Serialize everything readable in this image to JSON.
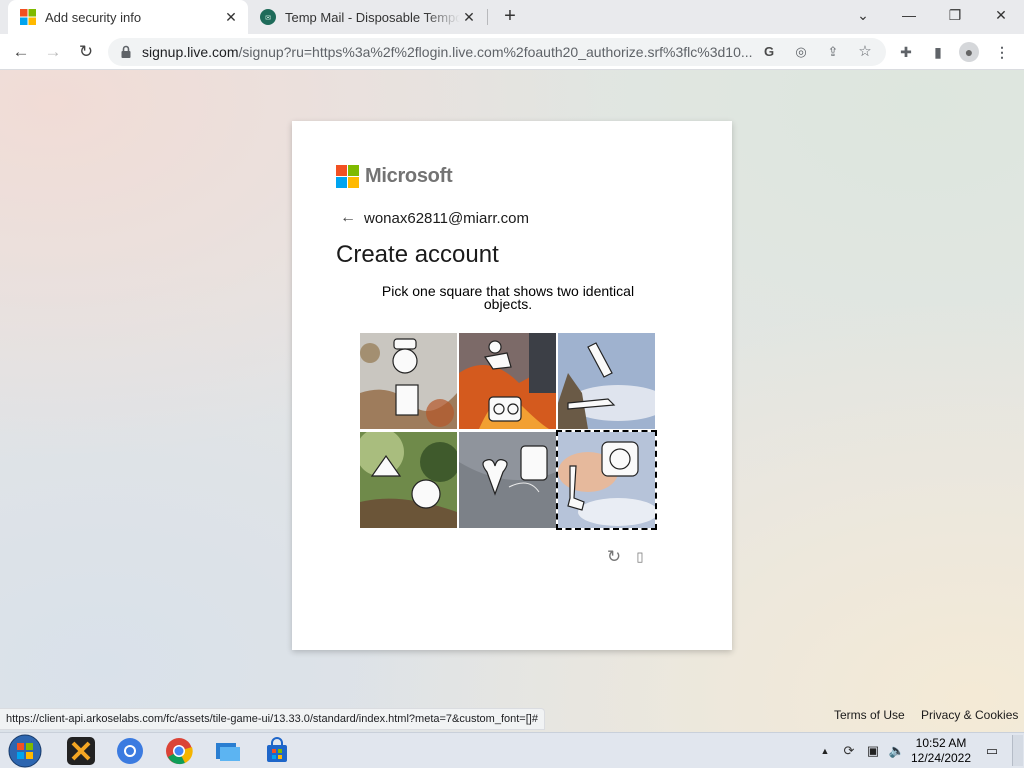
{
  "browser": {
    "tabs": [
      {
        "title": "Add security info",
        "active": true
      },
      {
        "title": "Temp Mail - Disposable Temporary Email",
        "active": false
      }
    ],
    "url_host": "signup.live.com",
    "url_rest": "/signup?ru=https%3a%2f%2flogin.live.com%2foauth20_authorize.srf%3flc%3d10...",
    "status_url": "https://client-api.arkoselabs.com/fc/assets/tile-game-ui/13.33.0/standard/index.html?meta=7&custom_font=[]#"
  },
  "card": {
    "brand": "Microsoft",
    "email": "wonax62811@miarr.com",
    "heading": "Create account",
    "prompt": "Pick one square that shows two identical objects."
  },
  "footer": {
    "terms": "Terms of Use",
    "privacy": "Privacy & Cookies"
  },
  "taskbar": {
    "time": "10:52 AM",
    "date": "12/24/2022"
  },
  "colors": {
    "ms_red": "#f25022",
    "ms_green": "#7fba00",
    "ms_blue": "#00a4ef",
    "ms_yellow": "#ffb900"
  }
}
